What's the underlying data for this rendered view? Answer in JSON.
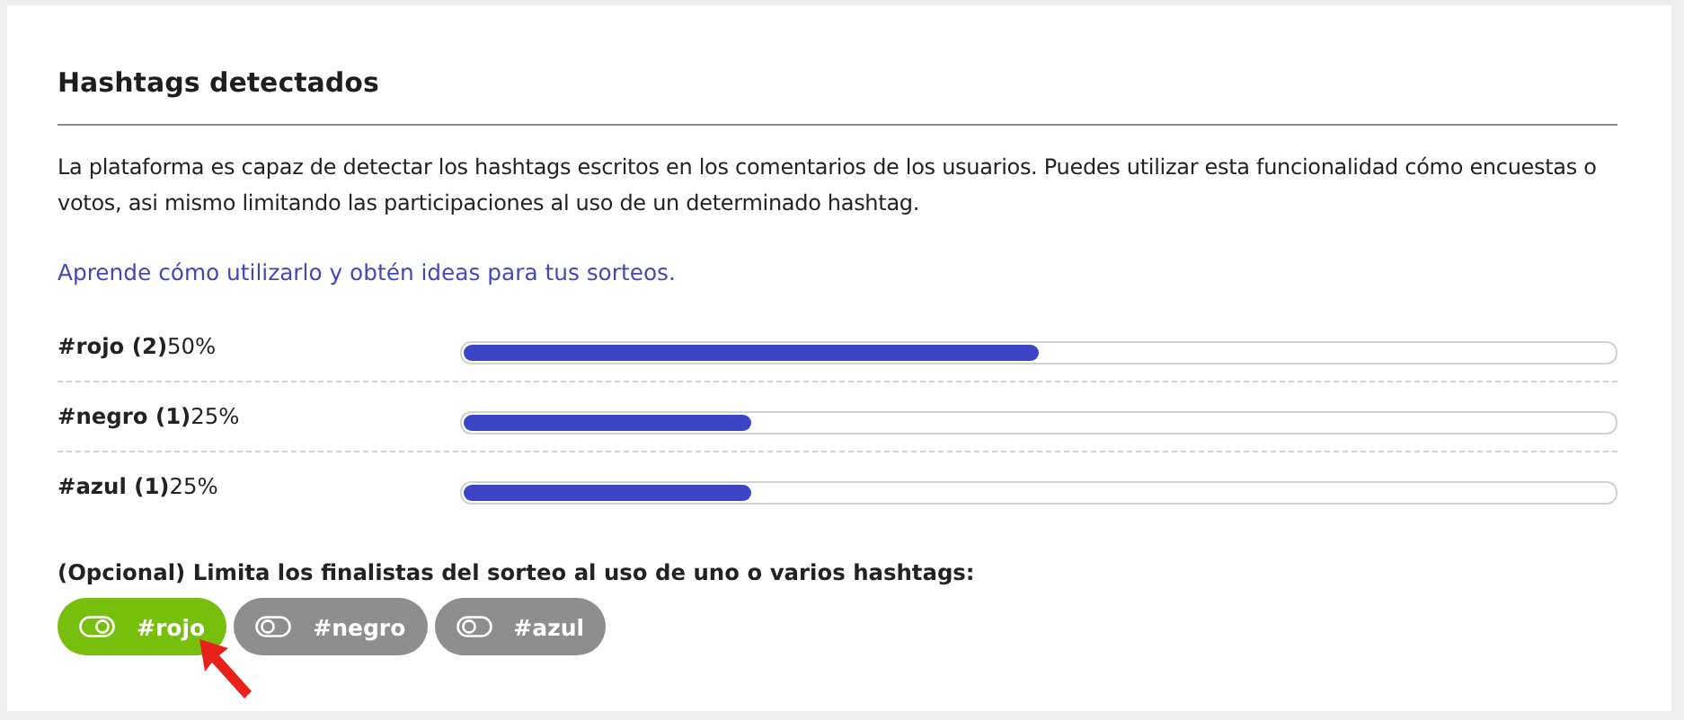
{
  "title": "Hashtags detectados",
  "description": "La plataforma es capaz de detectar los hashtags escritos en los comentarios de los usuarios. Puedes utilizar esta funcionalidad cómo encuestas o votos, asi mismo limitando las participaciones al uso de un determinado hashtag.",
  "help_link": "Aprende cómo utilizarlo y obtén ideas para tus sorteos.",
  "hashtags": [
    {
      "label": "#rojo (2)",
      "percent": "50%",
      "level": 0.5
    },
    {
      "label": "#negro (1)",
      "percent": "25%",
      "level": 0.25
    },
    {
      "label": "#azul (1)",
      "percent": "25%",
      "level": 0.25
    }
  ],
  "filter_label": "(Opcional) Limita los finalistas del sorteo al uso de uno o varios hashtags:",
  "filters": [
    {
      "label": "#rojo",
      "selected": true
    },
    {
      "label": "#negro",
      "selected": false
    },
    {
      "label": "#azul",
      "selected": false
    }
  ]
}
